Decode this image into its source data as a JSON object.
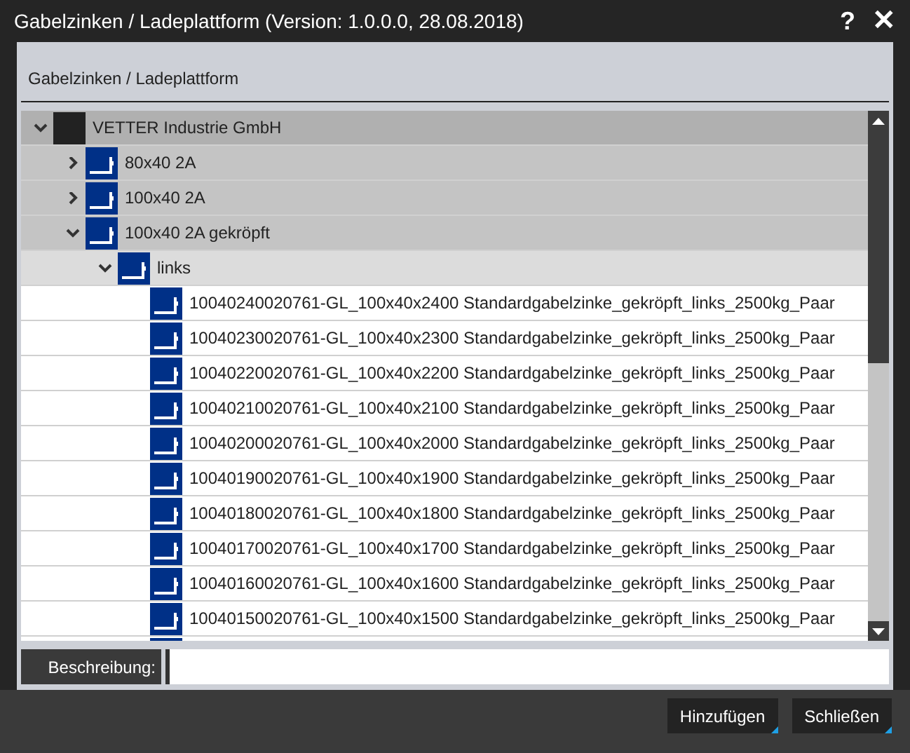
{
  "window": {
    "title": "Gabelzinken / Ladeplattform (Version: 1.0.0.0, 28.08.2018)",
    "help": "?",
    "close": "✕"
  },
  "section_title": "Gabelzinken / Ladeplattform",
  "tree": [
    {
      "label": "VETTER Industrie GmbH",
      "kind": "company",
      "expanded": true,
      "children": [
        {
          "label": "80x40 2A",
          "kind": "fork",
          "expanded": false
        },
        {
          "label": "100x40 2A",
          "kind": "fork",
          "expanded": false
        },
        {
          "label": "100x40 2A gekröpft",
          "kind": "fork",
          "expanded": true,
          "children": [
            {
              "label": "links",
              "kind": "fork",
              "expanded": true,
              "children": [
                {
                  "label": "10040240020761-GL_100x40x2400 Standardgabelzinke_gekröpft_links_2500kg_Paar",
                  "kind": "fork"
                },
                {
                  "label": "10040230020761-GL_100x40x2300 Standardgabelzinke_gekröpft_links_2500kg_Paar",
                  "kind": "fork"
                },
                {
                  "label": "10040220020761-GL_100x40x2200 Standardgabelzinke_gekröpft_links_2500kg_Paar",
                  "kind": "fork"
                },
                {
                  "label": "10040210020761-GL_100x40x2100 Standardgabelzinke_gekröpft_links_2500kg_Paar",
                  "kind": "fork"
                },
                {
                  "label": "10040200020761-GL_100x40x2000 Standardgabelzinke_gekröpft_links_2500kg_Paar",
                  "kind": "fork"
                },
                {
                  "label": "10040190020761-GL_100x40x1900 Standardgabelzinke_gekröpft_links_2500kg_Paar",
                  "kind": "fork"
                },
                {
                  "label": "10040180020761-GL_100x40x1800 Standardgabelzinke_gekröpft_links_2500kg_Paar",
                  "kind": "fork"
                },
                {
                  "label": "10040170020761-GL_100x40x1700 Standardgabelzinke_gekröpft_links_2500kg_Paar",
                  "kind": "fork"
                },
                {
                  "label": "10040160020761-GL_100x40x1600 Standardgabelzinke_gekröpft_links_2500kg_Paar",
                  "kind": "fork"
                },
                {
                  "label": "10040150020761-GL_100x40x1500 Standardgabelzinke_gekröpft_links_2500kg_Paar",
                  "kind": "fork"
                },
                {
                  "kind": "fork"
                }
              ]
            }
          ]
        }
      ]
    }
  ],
  "description": {
    "label": "Beschreibung:"
  },
  "buttons": [
    "Hinzufügen",
    "Schließen"
  ]
}
